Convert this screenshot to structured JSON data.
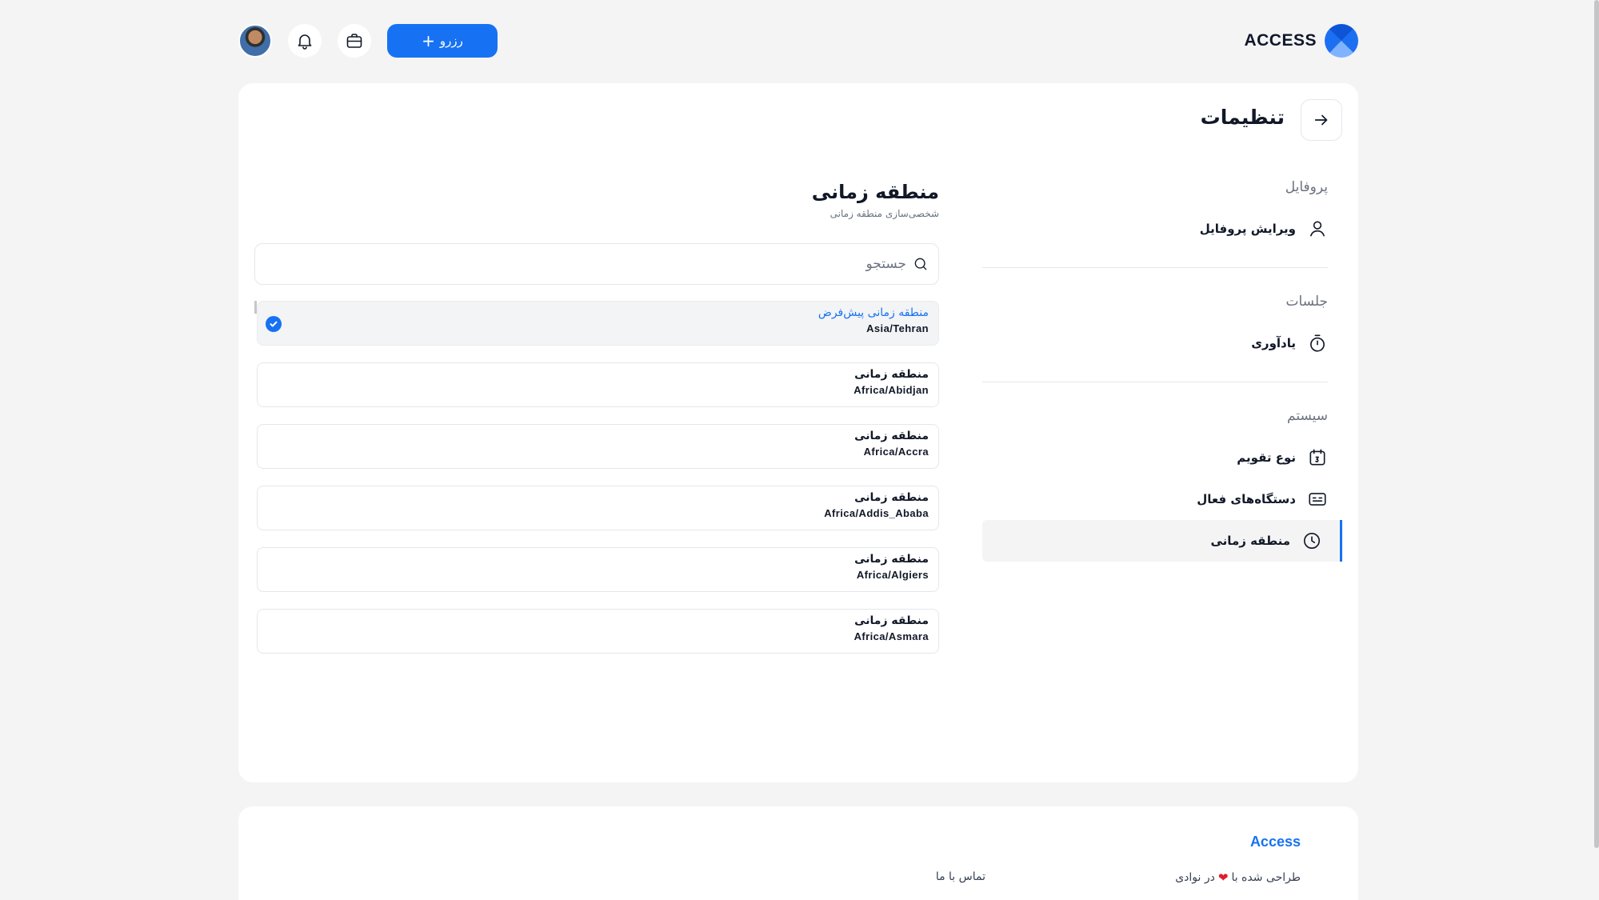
{
  "header": {
    "brand_name": "ACCESS",
    "reserve_button": "رزرو",
    "icons": [
      "avatar",
      "bell-icon",
      "briefcase-icon",
      "plus-icon"
    ]
  },
  "page": {
    "title": "تنظیمات"
  },
  "nav": {
    "sections": [
      {
        "title": "پروفایل",
        "items": [
          {
            "label": "ویرایش پروفایل",
            "icon": "user-icon"
          }
        ]
      },
      {
        "title": "جلسات",
        "items": [
          {
            "label": "یادآوری",
            "icon": "timer-icon"
          }
        ]
      },
      {
        "title": "سیستم",
        "items": [
          {
            "label": "نوع تقویم",
            "icon": "calendar-icon"
          },
          {
            "label": "دستگاه‌های فعال",
            "icon": "devices-icon"
          },
          {
            "label": "منطقه زمانی",
            "icon": "clock-icon",
            "active": true
          }
        ]
      }
    ]
  },
  "content": {
    "title": "منطقه زمانی",
    "subtitle": "شخصی‌سازی منطقه زمانی",
    "search_placeholder": "جستجو",
    "timezones": [
      {
        "label": "منطقه زمانی پیش‌فرض",
        "zone": "Asia/Tehran",
        "selected": true
      },
      {
        "label": "منطقه زمانی",
        "zone": "Africa/Abidjan"
      },
      {
        "label": "منطقه زمانی",
        "zone": "Africa/Accra"
      },
      {
        "label": "منطقه زمانی",
        "zone": "Africa/Addis_Ababa"
      },
      {
        "label": "منطقه زمانی",
        "zone": "Africa/Algiers"
      },
      {
        "label": "منطقه زمانی",
        "zone": "Africa/Asmara"
      }
    ]
  },
  "footer": {
    "brand": "Access",
    "credit_prefix": "طراحی شده با",
    "credit_suffix": "در نوادی",
    "contact": "تماس با ما"
  },
  "colors": {
    "accent": "#1672f3",
    "background": "#f4f4f5",
    "heart": "#e11d2e"
  }
}
